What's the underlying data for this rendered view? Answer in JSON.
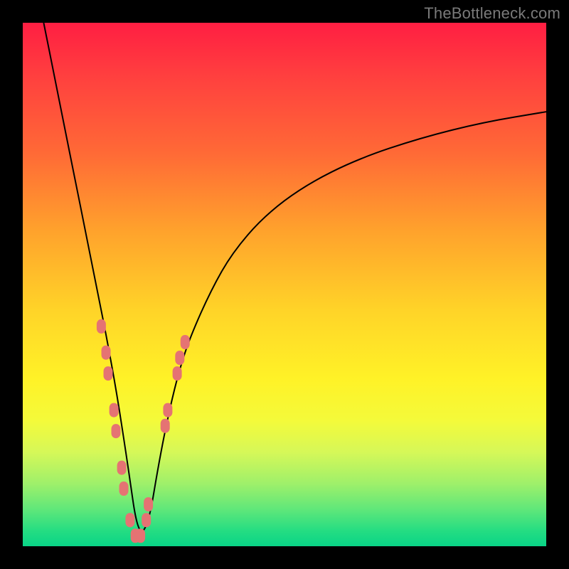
{
  "watermark": "TheBottleneck.com",
  "colors": {
    "frame": "#000000",
    "curve": "#000000",
    "bead": "#e57373"
  },
  "chart_data": {
    "type": "line",
    "title": "",
    "xlabel": "",
    "ylabel": "",
    "xlim": [
      0,
      100
    ],
    "ylim": [
      0,
      100
    ],
    "gradient_background": true,
    "curve_description": "V-shaped bottleneck curve; steep descent on left, minimum near x≈22, asymptotic rise on right",
    "series": [
      {
        "name": "bottleneck-curve",
        "x": [
          4,
          6,
          8,
          10,
          12,
          14,
          16,
          18,
          20,
          22,
          24,
          26,
          28,
          30,
          32,
          36,
          40,
          46,
          54,
          64,
          76,
          88,
          100
        ],
        "y": [
          100,
          90,
          80,
          70,
          60,
          50,
          40,
          29,
          16,
          2,
          4,
          16,
          26,
          34,
          40,
          49,
          56,
          63,
          69,
          74,
          78,
          81,
          83
        ]
      }
    ],
    "beads_description": "Clustered pink markers along lower V region of curve",
    "beads": [
      {
        "x": 15.0,
        "y": 42
      },
      {
        "x": 15.9,
        "y": 37
      },
      {
        "x": 16.3,
        "y": 33
      },
      {
        "x": 17.4,
        "y": 26
      },
      {
        "x": 17.8,
        "y": 22
      },
      {
        "x": 18.9,
        "y": 15
      },
      {
        "x": 19.3,
        "y": 11
      },
      {
        "x": 20.5,
        "y": 5
      },
      {
        "x": 21.5,
        "y": 2
      },
      {
        "x": 22.5,
        "y": 2
      },
      {
        "x": 23.6,
        "y": 5
      },
      {
        "x": 24.0,
        "y": 8
      },
      {
        "x": 27.2,
        "y": 23
      },
      {
        "x": 27.7,
        "y": 26
      },
      {
        "x": 29.5,
        "y": 33
      },
      {
        "x": 30.0,
        "y": 36
      },
      {
        "x": 31.0,
        "y": 39
      }
    ]
  }
}
